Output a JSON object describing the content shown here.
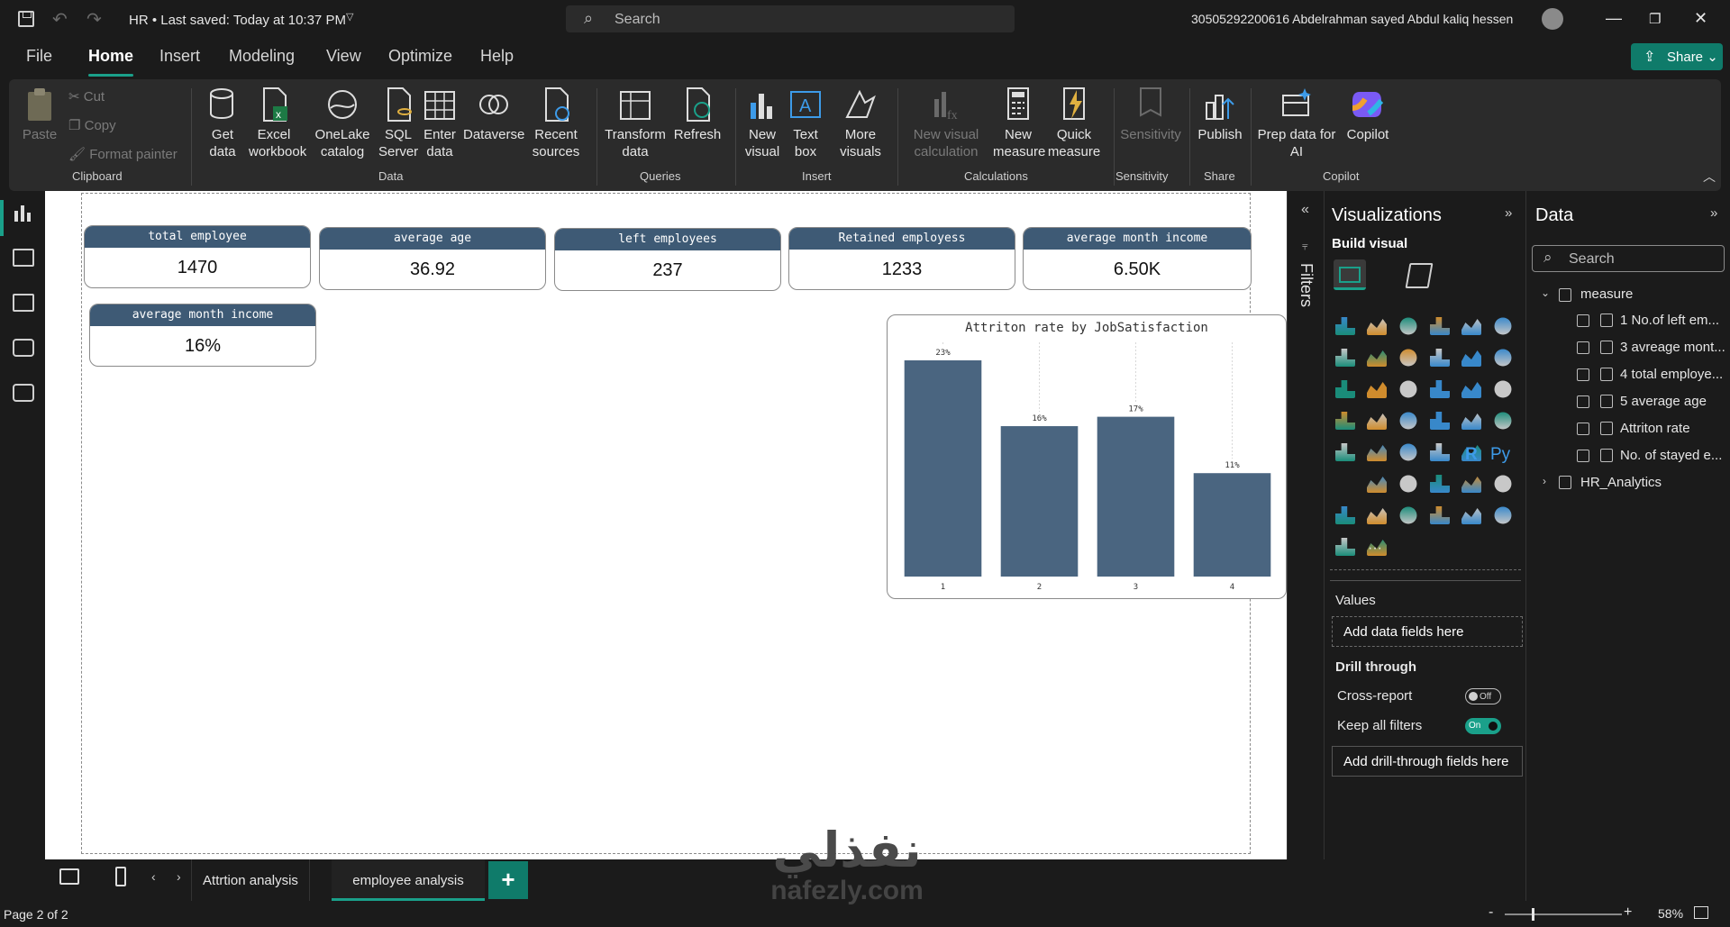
{
  "titlebar": {
    "title": "HR • Last saved: Today at 10:37 PM",
    "search_placeholder": "Search",
    "user": "30505292200616 Abdelrahman sayed Abdul kaliq hessen"
  },
  "menu": [
    "File",
    "Home",
    "Insert",
    "Modeling",
    "View",
    "Optimize",
    "Help"
  ],
  "share_label": "Share",
  "ribbon": {
    "clipboard": {
      "paste": "Paste",
      "cut": "Cut",
      "copy": "Copy",
      "format_painter": "Format painter",
      "group": "Clipboard"
    },
    "data": {
      "get_data": "Get data",
      "excel": "Excel workbook",
      "onelake": "OneLake catalog",
      "sql": "SQL Server",
      "enter": "Enter data",
      "dataverse": "Dataverse",
      "recent": "Recent sources",
      "group": "Data"
    },
    "queries": {
      "transform": "Transform data",
      "refresh": "Refresh",
      "group": "Queries"
    },
    "insert": {
      "new_visual": "New visual",
      "text_box": "Text box",
      "more_visuals": "More visuals",
      "group": "Insert"
    },
    "calculations": {
      "new_visual_calc": "New visual calculation",
      "new_measure": "New measure",
      "quick_measure": "Quick measure",
      "group": "Calculations"
    },
    "sensitivity": {
      "label": "Sensitivity",
      "group": "Sensitivity"
    },
    "share": {
      "publish": "Publish",
      "group": "Share"
    },
    "copilot": {
      "prep": "Prep data for AI",
      "copilot": "Copilot",
      "group": "Copilot"
    }
  },
  "kpis": [
    {
      "label": "total employee",
      "value": "1470"
    },
    {
      "label": "average age",
      "value": "36.92"
    },
    {
      "label": "left employees",
      "value": "237"
    },
    {
      "label": "Retained employess",
      "value": "1233"
    },
    {
      "label": "average month income",
      "value": "6.50K"
    },
    {
      "label": "average month income",
      "value": "16%"
    }
  ],
  "chart_data": {
    "type": "bar",
    "title": "Attriton rate by JobSatisfaction",
    "categories": [
      "1",
      "2",
      "3",
      "4"
    ],
    "values": [
      23,
      16,
      17,
      11
    ],
    "data_labels": [
      "23%",
      "16%",
      "17%",
      "11%"
    ],
    "ylim": [
      0,
      23
    ],
    "color": "#4a6580"
  },
  "filters_label": "Filters",
  "visualizations": {
    "title": "Visualizations",
    "build_visual": "Build visual",
    "values_label": "Values",
    "add_data_fields": "Add data fields here",
    "drill_through": "Drill through",
    "cross_report": "Cross-report",
    "cross_report_state": "Off",
    "keep_filters": "Keep all filters",
    "keep_filters_state": "On",
    "add_drill": "Add drill-through fields here",
    "more": "···",
    "r_label": "R",
    "py_label": "Py"
  },
  "data_pane": {
    "title": "Data",
    "search_placeholder": "Search",
    "tables": [
      {
        "name": "measure",
        "expanded": true,
        "fields": [
          "1 No.of left em...",
          "3 avreage mont...",
          "4 total employe...",
          "5 average age",
          "Attriton rate",
          "No. of stayed e..."
        ]
      },
      {
        "name": "HR_Analytics",
        "expanded": false,
        "fields": []
      }
    ]
  },
  "tabs": [
    "Attrtion analysis",
    "employee analysis"
  ],
  "active_tab": "employee analysis",
  "status": {
    "page": "Page 2 of 2",
    "zoom": "58%"
  },
  "watermark": {
    "arabic": "نفذلي",
    "latin": "nafezly.com"
  },
  "colors": {
    "accent": "#1aa08a",
    "kpi_header": "#3e5a75",
    "bar": "#4a6580"
  }
}
